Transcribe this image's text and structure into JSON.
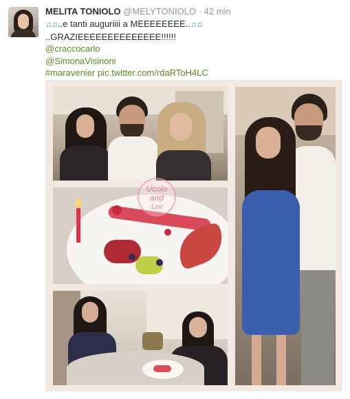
{
  "tweet": {
    "author_name": "MELITA TONIOLO",
    "author_handle": "@MELYTONIOLO",
    "separator": "·",
    "time": "42 min",
    "note_emoji": "♫♫",
    "text_line1": "..e tanti auguriiii a MEEEEEEEE..",
    "text_line2": "..GRAZIEEEEEEEEEEEEEE!!!!!!",
    "mentions": [
      "@craccocarlo",
      "@SimonaVisinoni"
    ],
    "hashtag": "#maravenier",
    "media_link": "pic.twitter.com/rdaRToH4LC"
  },
  "photo": {
    "watermark_lines": [
      "Ucolo",
      "and",
      "Lov"
    ],
    "candle_color": "#e0304a",
    "sauce_color": "#d94a5a",
    "dress_color": "#3a5fae"
  }
}
